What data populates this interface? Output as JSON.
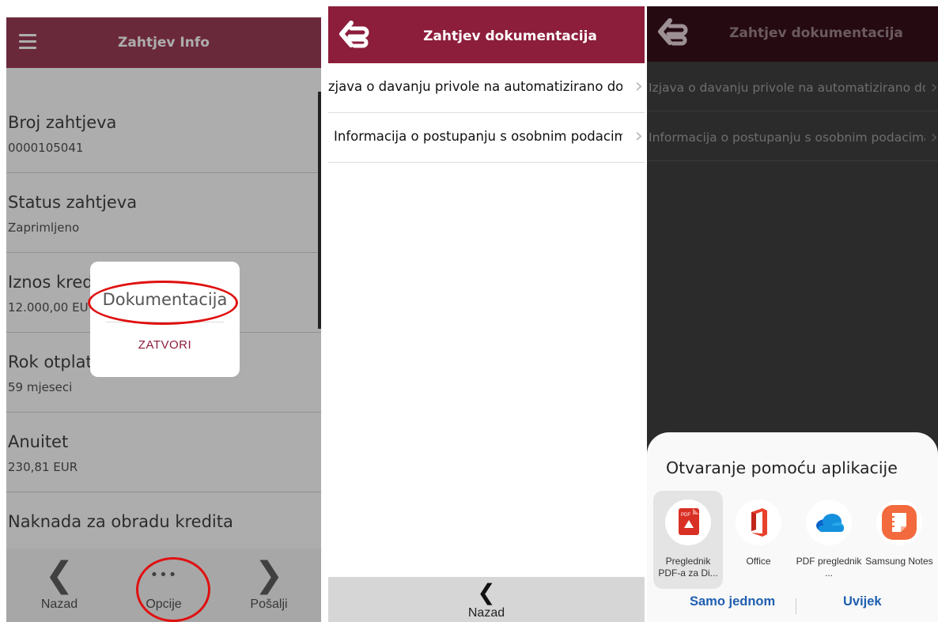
{
  "panel1": {
    "header": {
      "title": "Zahtjev Info"
    },
    "rows": [
      {
        "label": "Broj zahtjeva",
        "value": "0000105041"
      },
      {
        "label": "Status zahtjeva",
        "value": "Zaprimljeno"
      },
      {
        "label": "Iznos kred",
        "value": "12.000,00 EU"
      },
      {
        "label": "Rok otplat",
        "value": "59 mjeseci"
      },
      {
        "label": "Anuitet",
        "value": "230,81 EUR"
      },
      {
        "label": "Naknada za obradu kredita",
        "value": ""
      }
    ],
    "dialog": {
      "title": "Dokumentacija",
      "button": "ZATVORI"
    },
    "bottom_nav": [
      {
        "icon": "chevron-left-icon",
        "glyph": "❮",
        "label": "Nazad"
      },
      {
        "icon": "more-dots-icon",
        "glyph": "•••",
        "label": "Opcije"
      },
      {
        "icon": "chevron-right-icon",
        "glyph": "❯",
        "label": "Pošalji"
      }
    ],
    "colors": {
      "brand": "#8c1d3b",
      "annotation": "#e01010"
    }
  },
  "panel2": {
    "header": {
      "title": "Zahtjev dokumentacija"
    },
    "items": [
      {
        "text": "Izjava o davanju privole na automatizirano donošenje odluka"
      },
      {
        "text": "Informacija o postupanju s osobnim podacima"
      }
    ],
    "bottom": {
      "glyph": "❮",
      "label": "Nazad"
    }
  },
  "panel3": {
    "header": {
      "title": "Zahtjev dokumentacija"
    },
    "items": [
      {
        "text": "Izjava o davanju privole na automatizirano donošenje odluka"
      },
      {
        "text": "Informacija o postupanju s osobnim podacima"
      }
    ],
    "sheet": {
      "title": "Otvaranje pomoću aplikacije",
      "apps": [
        {
          "name": "Preglednik PDF-a za Di...",
          "icon": "pdf-viewer-icon",
          "selected": true
        },
        {
          "name": "Office",
          "icon": "office-icon",
          "selected": false
        },
        {
          "name": "PDF preglednik ...",
          "icon": "onedrive-icon",
          "selected": false
        },
        {
          "name": "Samsung Notes",
          "icon": "samsung-notes-icon",
          "selected": false
        }
      ],
      "once_label": "Samo jednom",
      "always_label": "Uvijek"
    }
  }
}
